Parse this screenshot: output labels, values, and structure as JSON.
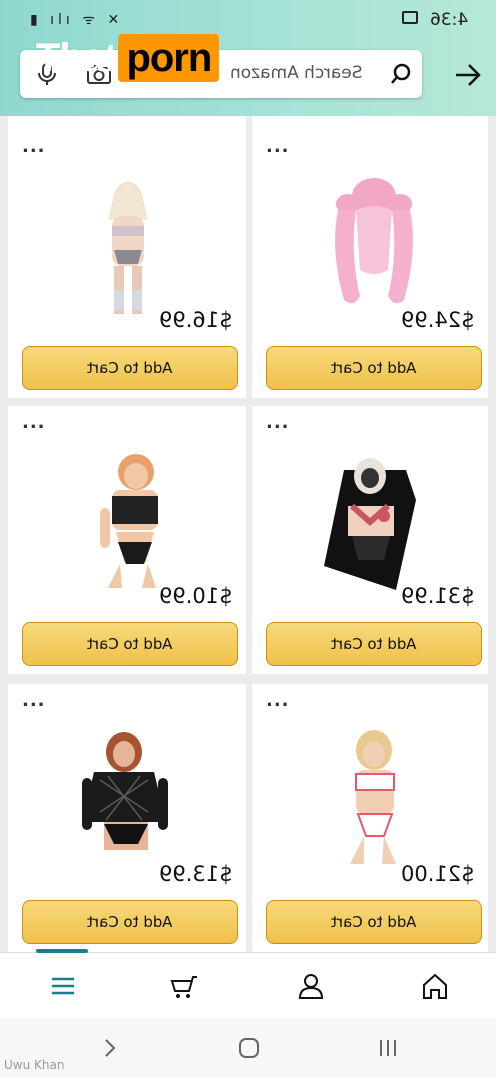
{
  "status": {
    "time": "4:36"
  },
  "watermark": {
    "text": "That",
    "badge": "porn"
  },
  "search": {
    "placeholder": "Search Amazon"
  },
  "products": [
    {
      "price": "$16.99",
      "button": "Add to Cart"
    },
    {
      "price": "$24.99",
      "button": "Add to Cart"
    },
    {
      "price": "$10.99",
      "button": "Add to Cart"
    },
    {
      "price": "$31.99",
      "button": "Add to Cart"
    },
    {
      "price": "$13.99",
      "button": "Add to Cart"
    },
    {
      "price": "$21.00",
      "button": "Add to Cart"
    }
  ],
  "more_label": "...",
  "footer": {
    "credit": "Uwu Khan"
  },
  "colors": {
    "header": "#a7e3d6",
    "button": "#f0c14b",
    "accent": "#1b7d8c"
  }
}
